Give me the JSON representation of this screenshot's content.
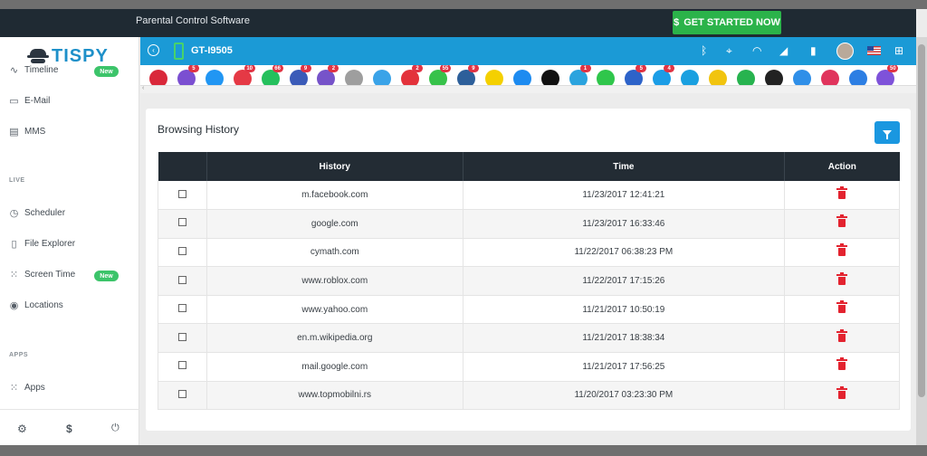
{
  "topbar": {
    "title": "Parental Control Software",
    "cta_label": "GET STARTED NOW",
    "cta_icon": "dollar-icon"
  },
  "logo": {
    "brand": "TISPY"
  },
  "sidebar": {
    "items": [
      {
        "label": "Timeline",
        "icon": "pulse-icon",
        "badge": "New"
      },
      {
        "label": "E-Mail",
        "icon": "inbox-icon"
      },
      {
        "label": "MMS",
        "icon": "film-icon"
      }
    ],
    "live_label": "LIVE",
    "live_items": [
      {
        "label": "Scheduler",
        "icon": "clock-icon"
      },
      {
        "label": "File Explorer",
        "icon": "file-icon"
      },
      {
        "label": "Screen Time",
        "icon": "grid-icon",
        "badge": "New"
      },
      {
        "label": "Locations",
        "icon": "pin-icon"
      }
    ],
    "apps_label": "APPS",
    "apps_items": [
      {
        "label": "Apps",
        "icon": "grid-icon"
      }
    ],
    "footer": [
      "settings-icon",
      "dollar-icon",
      "power-icon"
    ]
  },
  "device": {
    "name": "GT-I9505"
  },
  "apps": [
    {
      "name": "video-icon",
      "color": "#d9283a",
      "count": ""
    },
    {
      "name": "viber-icon",
      "color": "#7b4fd1",
      "count": "5"
    },
    {
      "name": "mail-icon",
      "color": "#2196f3",
      "count": ""
    },
    {
      "name": "photos-icon",
      "color": "#e53945",
      "count": "10"
    },
    {
      "name": "whatsapp-icon",
      "color": "#25c05d",
      "count": "66"
    },
    {
      "name": "facebook-icon",
      "color": "#3b5bb8",
      "count": "9"
    },
    {
      "name": "viber2-icon",
      "color": "#7653c9",
      "count": "2"
    },
    {
      "name": "generic-app-icon",
      "color": "#9e9e9e",
      "count": ""
    },
    {
      "name": "chat-icon",
      "color": "#3aa3e8",
      "count": ""
    },
    {
      "name": "tinder-icon",
      "color": "#e3323b",
      "count": "2"
    },
    {
      "name": "wechat-icon",
      "color": "#37c24a",
      "count": "55"
    },
    {
      "name": "instagram-icon",
      "color": "#2d5f9a",
      "count": "9"
    },
    {
      "name": "snapchat-icon",
      "color": "#f4d000",
      "count": ""
    },
    {
      "name": "flickr-icon",
      "color": "#1d8bf0",
      "count": ""
    },
    {
      "name": "tiktok-icon",
      "color": "#111111",
      "count": ""
    },
    {
      "name": "telegram-icon",
      "color": "#2aa3de",
      "count": "1"
    },
    {
      "name": "line-icon",
      "color": "#2fc64b",
      "count": ""
    },
    {
      "name": "messenger-icon",
      "color": "#2d63c9",
      "count": "5"
    },
    {
      "name": "skype-icon",
      "color": "#1b9de6",
      "count": "4"
    },
    {
      "name": "bip-icon",
      "color": "#1aa0e0",
      "count": ""
    },
    {
      "name": "talk-icon",
      "color": "#f1c40f",
      "count": ""
    },
    {
      "name": "hangouts-icon",
      "color": "#27b34f",
      "count": ""
    },
    {
      "name": "kik-icon",
      "color": "#222222",
      "count": ""
    },
    {
      "name": "app2-icon",
      "color": "#2f8fe8",
      "count": ""
    },
    {
      "name": "camera-icon",
      "color": "#e0345c",
      "count": ""
    },
    {
      "name": "app3-icon",
      "color": "#2c7ee3",
      "count": ""
    },
    {
      "name": "app4-icon",
      "color": "#7e52d9",
      "count": "50"
    }
  ],
  "page": {
    "heading": "Browsing History",
    "columns": [
      "",
      "History",
      "Time",
      "Action"
    ],
    "rows": [
      {
        "history": "m.facebook.com",
        "time": "11/23/2017 12:41:21"
      },
      {
        "history": "google.com",
        "time": "11/23/2017 16:33:46"
      },
      {
        "history": "cymath.com",
        "time": "11/22/2017 06:38:23 PM"
      },
      {
        "history": "www.roblox.com",
        "time": "11/22/2017 17:15:26"
      },
      {
        "history": "www.yahoo.com",
        "time": "11/21/2017 10:50:19"
      },
      {
        "history": "en.m.wikipedia.org",
        "time": "11/21/2017 18:38:34"
      },
      {
        "history": "mail.google.com",
        "time": "11/21/2017 17:56:25"
      },
      {
        "history": "www.topmobilni.rs",
        "time": "11/20/2017 03:23:30 PM"
      }
    ]
  },
  "colors": {
    "accent": "#1b9ad6",
    "topbar": "#1f2a33",
    "cta": "#2bb34a",
    "delete": "#e3232f",
    "table_header": "#232c34"
  }
}
